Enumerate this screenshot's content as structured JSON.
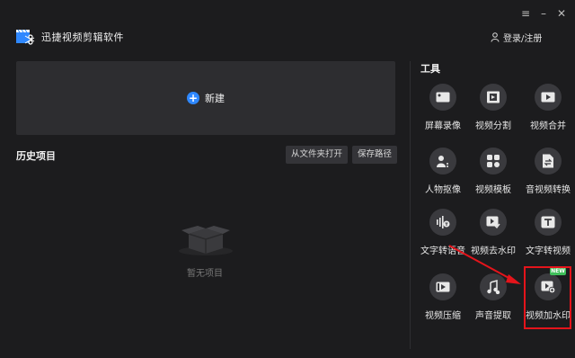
{
  "app": {
    "title": "迅捷视频剪辑软件"
  },
  "header": {
    "login_label": "登录/注册"
  },
  "new_project": {
    "label": "新建"
  },
  "history": {
    "title": "历史项目",
    "open_folder_label": "从文件夹打开",
    "save_path_label": "保存路径",
    "empty_text": "暂无项目"
  },
  "tools": {
    "title": "工具",
    "items": [
      {
        "label": "屏幕录像",
        "icon": "screen-record-icon"
      },
      {
        "label": "视频分割",
        "icon": "film-split-icon"
      },
      {
        "label": "视频合并",
        "icon": "play-merge-icon"
      },
      {
        "label": "人物抠像",
        "icon": "person-cutout-icon"
      },
      {
        "label": "视频模板",
        "icon": "template-grid-icon"
      },
      {
        "label": "音视频转换",
        "icon": "convert-file-icon"
      },
      {
        "label": "文字转语音",
        "icon": "audio-wave-icon"
      },
      {
        "label": "视频去水印",
        "icon": "remove-watermark-icon"
      },
      {
        "label": "文字转视频",
        "icon": "text-t-icon"
      },
      {
        "label": "视频压缩",
        "icon": "compress-video-icon"
      },
      {
        "label": "声音提取",
        "icon": "music-note-icon"
      },
      {
        "label": "视频加水印",
        "icon": "add-watermark-icon"
      }
    ],
    "new_badge": "NEW"
  },
  "colors": {
    "accent": "#2f88ff",
    "highlight": "#e4141b",
    "badge": "#3fbf5a"
  }
}
